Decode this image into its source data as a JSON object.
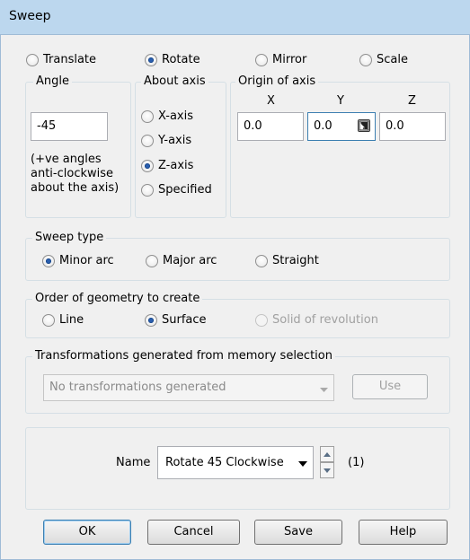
{
  "dialog": {
    "title": "Sweep"
  },
  "mode": {
    "options": [
      {
        "label": "Translate",
        "checked": false
      },
      {
        "label": "Rotate",
        "checked": true
      },
      {
        "label": "Mirror",
        "checked": false
      },
      {
        "label": "Scale",
        "checked": false
      }
    ]
  },
  "angle": {
    "group_label": "Angle",
    "value": "-45",
    "note_line1": "(+ve angles",
    "note_line2": "anti-clockwise",
    "note_line3": "about the axis)"
  },
  "about_axis": {
    "group_label": "About axis",
    "options": [
      {
        "label": "X-axis",
        "checked": false
      },
      {
        "label": "Y-axis",
        "checked": false
      },
      {
        "label": "Z-axis",
        "checked": true
      },
      {
        "label": "Specified",
        "checked": false
      }
    ]
  },
  "origin": {
    "group_label": "Origin of axis",
    "x_label": "X",
    "y_label": "Y",
    "z_label": "Z",
    "x_value": "0.0",
    "y_value": "0.0",
    "z_value": "0.0"
  },
  "sweep_type": {
    "group_label": "Sweep type",
    "options": [
      {
        "label": "Minor arc",
        "checked": true
      },
      {
        "label": "Major arc",
        "checked": false
      },
      {
        "label": "Straight",
        "checked": false
      }
    ]
  },
  "order": {
    "group_label": "Order of geometry to create",
    "options": [
      {
        "label": "Line",
        "checked": false,
        "disabled": false
      },
      {
        "label": "Surface",
        "checked": true,
        "disabled": false
      },
      {
        "label": "Solid of revolution",
        "checked": false,
        "disabled": true
      }
    ]
  },
  "transformations": {
    "group_label": "Transformations generated from memory selection",
    "dropdown_value": "No transformations generated",
    "use_label": "Use"
  },
  "name": {
    "label": "Name",
    "value": "Rotate 45 Clockwise",
    "count": "(1)"
  },
  "buttons": {
    "ok": "OK",
    "cancel": "Cancel",
    "save": "Save",
    "help": "Help"
  },
  "colors": {
    "titlebar": "#bcd7ee",
    "dialog_bg": "#f0f0f0",
    "radio_dot": "#2a5fb0"
  }
}
